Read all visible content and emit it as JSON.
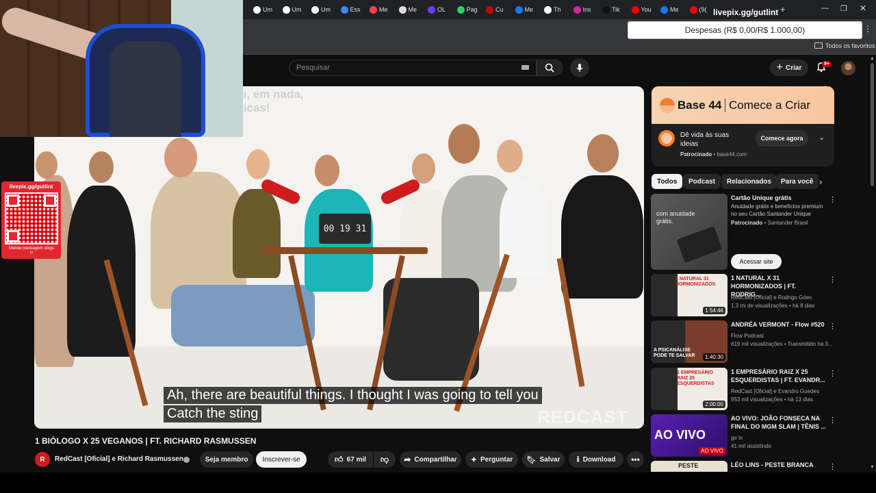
{
  "browser": {
    "tabs": [
      "Um",
      "Um",
      "Um",
      "Ess",
      "Me",
      "Me",
      "OL",
      "Pag",
      "Cu",
      "Me",
      "Th",
      "Ins",
      "Tik",
      "You",
      "Me",
      "(9("
    ],
    "tab_colors": [
      "#ffffff",
      "#ffffff",
      "#ffffff",
      "#4285f4",
      "#ff4444",
      "#dddddd",
      "#6a3cf7",
      "#1ed760",
      "#cc0000",
      "#1877f2",
      "#ffffff",
      "#d6249f",
      "#111111",
      "#ff0000",
      "#1877f2",
      "#ff0000"
    ],
    "overlay_url": "livepix.gg/gutlint",
    "bookmark_folder": "Todos os favoritos"
  },
  "budget_popup": {
    "text": "Despesas (R$ 0,00/R$ 1.000,00)"
  },
  "livepix_widget": {
    "url": "livepix.gg/gutlint",
    "message": "Mande mensagem obigu !!!"
  },
  "youtube": {
    "search_placeholder": "Pesquisar",
    "create_label": "Criar",
    "notification_count": "9+"
  },
  "video": {
    "timer_display": "00 19 31",
    "watermark": "REDCAST",
    "caption_line1": "Ah, there are beautiful things. I thought I was going to tell you",
    "caption_line2": "Catch the sting",
    "bg_text_line1": "u, em nada,",
    "bg_text_line2": "ticas!",
    "title": "1 BIÓLOGO X 25 VEGANOS | FT. RICHARD RASMUSSEN",
    "channel": "RedCast [Oficial] e Richard Rasmussen",
    "join_label": "Seja membro",
    "subscribe_label": "Inscrever-se",
    "likes": "67 mil",
    "share_label": "Compartilhar",
    "ask_label": "Perguntar",
    "save_label": "Salvar",
    "download_label": "Download"
  },
  "ad": {
    "brand": "Base 44",
    "tagline": "Comece a Criar",
    "text": "Dê vida às suas ideias",
    "sponsored": "Patrocinado",
    "domain": "base44.com",
    "cta": "Comece agora"
  },
  "chips": [
    "Todos",
    "Podcast",
    "Relacionados",
    "Para você"
  ],
  "sponsored_rec": {
    "title": "Cartão Unique grátis",
    "desc": "Anuidade grátis e benefícios premium no seu Cartão Santander Unique",
    "sponsored": "Patrocinado",
    "advertiser": "Santander Brasil",
    "thumb_text": "com anuidade grátis.",
    "cta": "Acessar site"
  },
  "recommendations": [
    {
      "title": "1 NATURAL X 31 HORMONIZADOS | FT. RODRIG...",
      "channel": "RedCast [Oficial] e Rodrigo Góes",
      "meta": "1,3 mi de visualizações • há 8 dias",
      "duration": "1:54:46",
      "thumb_text": "1 NATURAL 31 HORMONIZADOS"
    },
    {
      "title": "ANDRÉA VERMONT - Flow #520",
      "channel": "Flow Podcast",
      "meta": "619 mil visualizações • Transmitido há 3...",
      "duration": "1:40:30",
      "thumb_text": "A PSICANÁLISE PODE TE SALVAR"
    },
    {
      "title": "1 EMPRESÁRIO RAIZ X 25 ESQUERDISTAS | FT. EVANDR...",
      "channel": "RedCast [Oficial] e Evandro Guedes",
      "meta": "953 mil visualizações • há 13 dias",
      "duration": "2:00:00",
      "thumb_text": "1 EMPRESÁRIO RAIZ 25 ESQUERDISTAS"
    },
    {
      "title": "AO VIVO: JOÃO FONSECA NA FINAL DO MGM SLAM | TÊNIS ...",
      "channel": "ge tv",
      "meta": "41 mil assistindo",
      "duration": "AO VIVO",
      "thumb_text": "AO VIVO"
    },
    {
      "title": "LÉO LINS - PESTE BRANCA",
      "channel": "",
      "meta": "",
      "duration": "",
      "thumb_text": "PESTE"
    }
  ]
}
